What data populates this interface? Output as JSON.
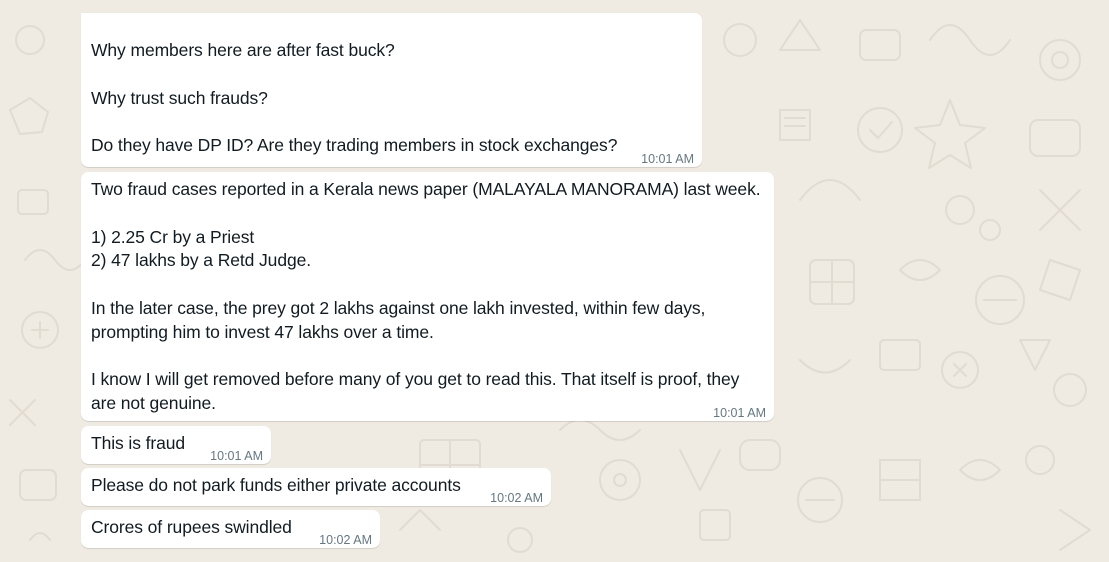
{
  "chat": {
    "messages": [
      {
        "text": "Why members here are after fast buck?\n\nWhy trust such frauds?\n\nDo they have DP ID? Are they trading members in stock exchanges?",
        "time": "10:01 AM"
      },
      {
        "text": "Two fraud cases reported in a Kerala news paper (MALAYALA MANORAMA) last week.\n\n1) 2.25 Cr by a Priest\n2) 47 lakhs by a Retd Judge.\n\nIn the later case, the prey got 2 lakhs against one lakh invested, within few days,\nprompting him to invest 47 lakhs over a time.\n\nI know I will get removed before many of you get to read this. That itself is proof, they\nare not genuine.",
        "time": "10:01 AM"
      },
      {
        "text": "This is fraud",
        "time": "10:01 AM"
      },
      {
        "text": "Please do not park funds either private accounts",
        "time": "10:02 AM"
      },
      {
        "text": "Crores of rupees swindled",
        "time": "10:02 AM"
      }
    ]
  },
  "colors": {
    "background": "#efeae2",
    "bubble": "#ffffff",
    "text": "#111b21",
    "timestamp": "#667781",
    "doodle": "#ddd6cc"
  }
}
